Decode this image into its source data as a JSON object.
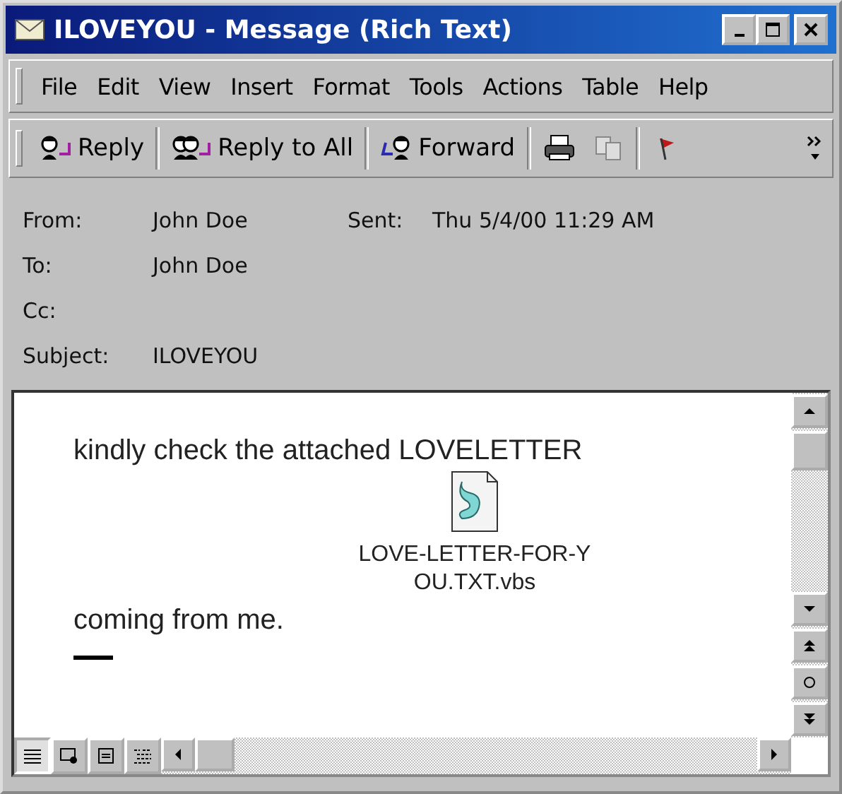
{
  "window": {
    "title": "ILOVEYOU - Message (Rich Text)"
  },
  "menu": [
    "File",
    "Edit",
    "View",
    "Insert",
    "Format",
    "Tools",
    "Actions",
    "Table",
    "Help"
  ],
  "toolbar": [
    {
      "kind": "reply",
      "label": "Reply"
    },
    {
      "kind": "replyall",
      "label": "Reply to All"
    },
    {
      "kind": "forward",
      "label": "Forward"
    },
    {
      "kind": "print"
    },
    {
      "kind": "copy"
    },
    {
      "kind": "flag"
    }
  ],
  "header": {
    "from_label": "From:",
    "from": "John Doe",
    "sent_label": "Sent:",
    "sent": "Thu 5/4/00 11:29 AM",
    "to_label": "To:",
    "to": "John Doe",
    "cc_label": "Cc:",
    "subject_label": "Subject:",
    "subject": "ILOVEYOU"
  },
  "body": {
    "line_1": "kindly check the attached LOVELETTER",
    "line_2": "coming from me.",
    "attachment": {
      "name_lines": [
        "LOVE-LETTER-FOR-Y",
        "OU.TXT.vbs"
      ]
    }
  },
  "view_buttons": [
    {
      "kind": "normal",
      "selected": true
    },
    {
      "kind": "web",
      "selected": false
    },
    {
      "kind": "page",
      "selected": false
    },
    {
      "kind": "outline",
      "selected": false
    }
  ]
}
